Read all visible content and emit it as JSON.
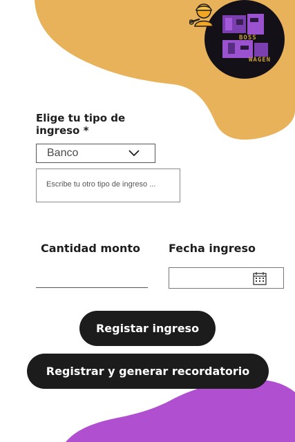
{
  "logo": {
    "word_top": "BOSS",
    "word_bottom": "WAGEN"
  },
  "form": {
    "income_type_label": "Elige tu tipo de ingreso *",
    "income_type_selected": "Banco",
    "other_income_placeholder": "Escribe tu otro tipo de ingreso ...",
    "amount_label": "Cantidad monto",
    "amount_value": "",
    "date_label": "Fecha ingreso",
    "date_value": ""
  },
  "buttons": {
    "register": "Registar ingreso",
    "register_reminder": "Registrar y generar recordatorio"
  },
  "colors": {
    "top_blob": "#E8B25B",
    "bottom_blob": "#B04FD0",
    "button_bg": "#1C1C1C",
    "button_text": "#FFFFFF"
  },
  "icons": {
    "worker": "worker-icon",
    "dropdown": "chevron-down-icon",
    "calendar": "calendar-icon"
  }
}
